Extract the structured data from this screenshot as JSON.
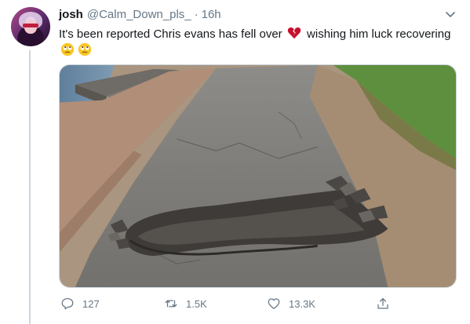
{
  "tweet": {
    "name": "josh",
    "handle": "@Calm_Down_pls_",
    "separator": "·",
    "time": "16h",
    "text_part1": "It's been reported Chris evans has fell over ",
    "text_part2": " wishing him luck recovering ",
    "emojis": [
      "broken-heart",
      "rolling-eyes-face",
      "rolling-eyes-face"
    ]
  },
  "actions": {
    "replies": "127",
    "retweets": "1.5K",
    "likes": "13.3K"
  },
  "colors": {
    "text": "#14171a",
    "secondary": "#657786",
    "border": "#ccd6dd",
    "heart": "#c8102e"
  }
}
